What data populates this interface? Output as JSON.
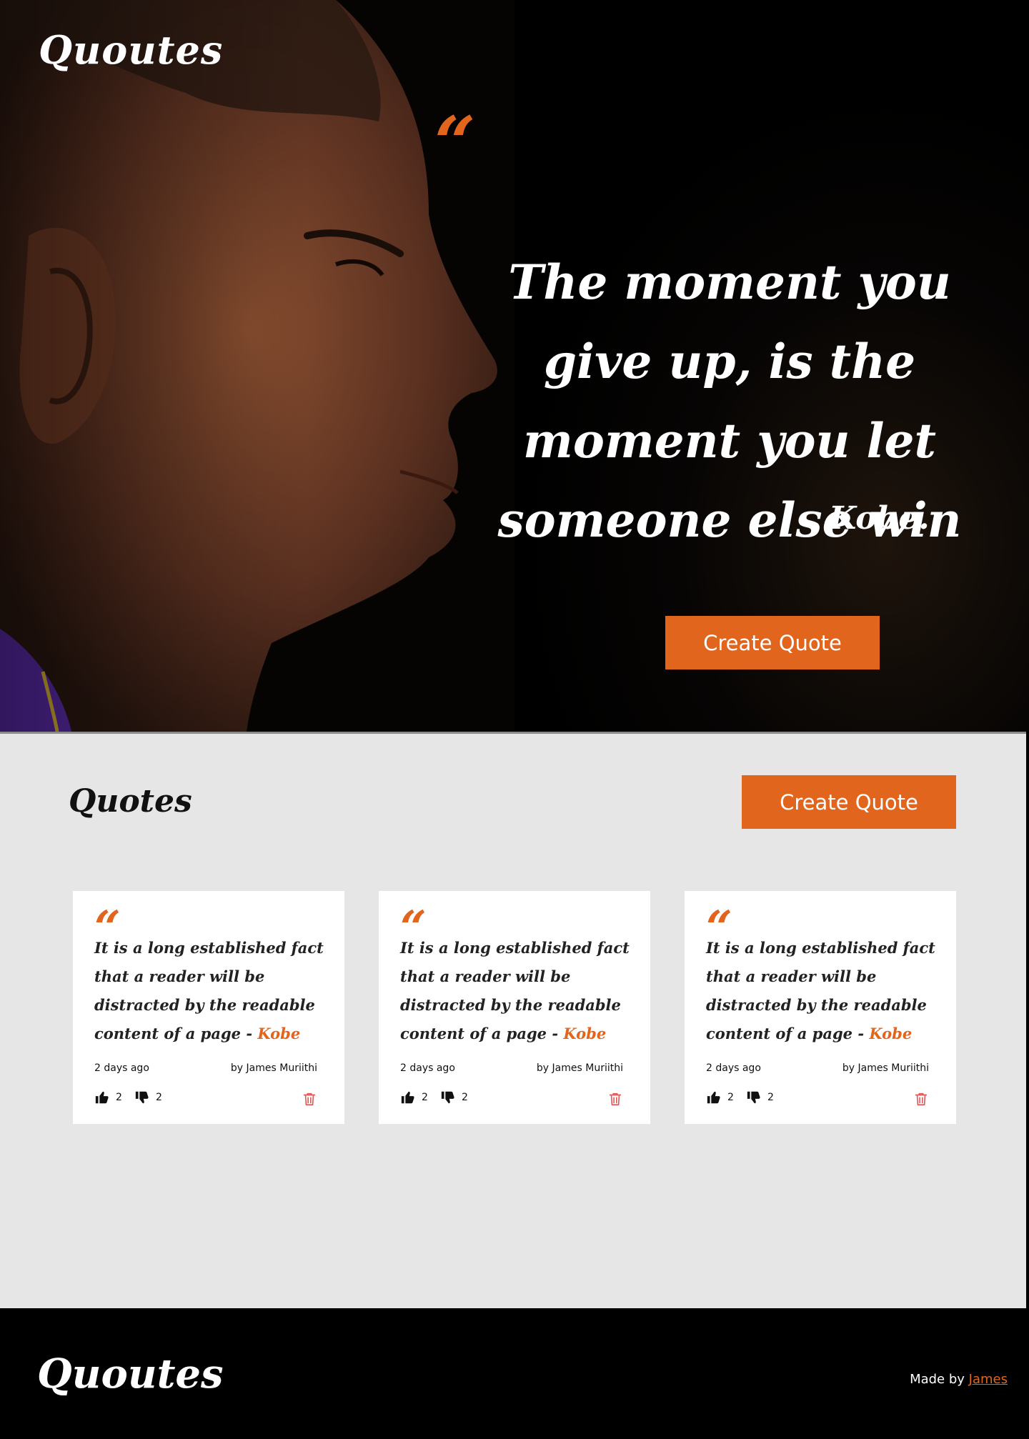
{
  "header": {
    "brand": "Quoutes"
  },
  "hero": {
    "quote_mark": "“",
    "quote": "The moment you give up, is the moment you let someone else win",
    "author": "Kobe.",
    "button_label": "Create Quote"
  },
  "quotes_section": {
    "title": "Quotes",
    "button_label": "Create Quote",
    "cards": [
      {
        "quote_mark": "“",
        "text": "It is a long established fact that a reader will be distracted by the readable content of a page -",
        "author": "Kobe",
        "time": "2 days ago",
        "by": "by James Muriithi",
        "upvotes": "2",
        "downvotes": "2"
      },
      {
        "quote_mark": "“",
        "text": "It is a long established fact that a reader will be distracted by the readable content of a page -",
        "author": "Kobe",
        "time": "2 days ago",
        "by": "by James Muriithi",
        "upvotes": "2",
        "downvotes": "2"
      },
      {
        "quote_mark": "“",
        "text": "It is a long established fact that a reader will be distracted by the readable content of a page -",
        "author": "Kobe",
        "time": "2 days ago",
        "by": "by James Muriithi",
        "upvotes": "2",
        "downvotes": "2"
      }
    ]
  },
  "footer": {
    "brand": "Quoutes",
    "made_by_prefix": "Made by",
    "made_by_link": "James"
  },
  "colors": {
    "accent": "#e2651e",
    "section_bg": "#e6e6e6",
    "dark_bg": "#000000",
    "delete_icon": "#e05a5a"
  },
  "icons": [
    "thumbs-up-icon",
    "thumbs-down-icon",
    "trash-icon",
    "quote-icon"
  ]
}
